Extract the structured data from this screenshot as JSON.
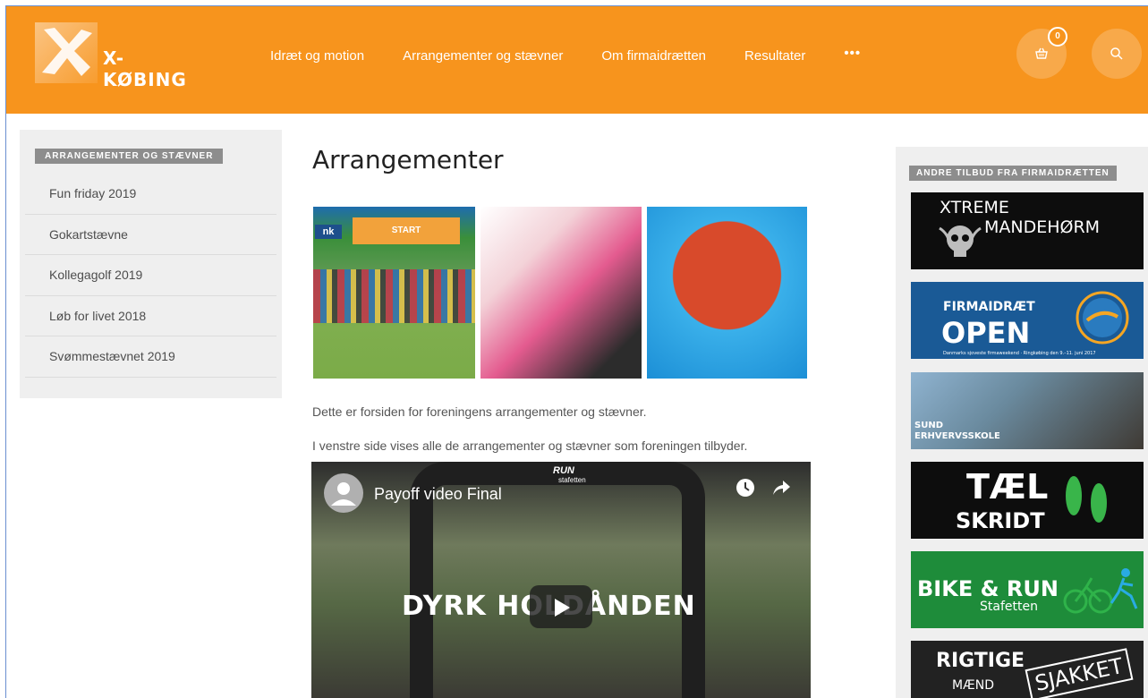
{
  "header": {
    "brand": "X-KØBING",
    "nav": [
      {
        "label": "Idræt og motion"
      },
      {
        "label": "Arrangementer og stævner"
      },
      {
        "label": "Om firmaidrætten"
      },
      {
        "label": "Resultater"
      }
    ],
    "more_label": "•••",
    "cart_count": "0",
    "cart_icon": "basket-icon",
    "search_icon": "search-icon",
    "accent_color": "#f7941d"
  },
  "sidebar": {
    "heading": "ARRANGEMENTER OG STÆVNER",
    "items": [
      {
        "label": "Fun friday 2019"
      },
      {
        "label": "Gokartstævne"
      },
      {
        "label": "Kollegagolf 2019"
      },
      {
        "label": "Løb for livet 2018"
      },
      {
        "label": "Svømmestævnet 2019"
      }
    ]
  },
  "main": {
    "title": "Arrangementer",
    "hero_banner": "START",
    "hero_side_text": "nk",
    "paragraphs": [
      "Dette er forsiden for foreningens arrangementer og stævner.",
      "I venstre side vises alle de arrangementer og stævner som foreningen tilbyder."
    ],
    "video": {
      "title": "Payoff video Final",
      "overlay_text": "DYRK HOLDÅNDEN",
      "arch_text": "RUN",
      "arch_subtext": "stafetten"
    }
  },
  "right_sidebar": {
    "heading": "ANDRE TILBUD FRA FIRMAIDRÆTTEN",
    "ads": [
      {
        "line1": "XTREME",
        "line2": "MANDEHØRM",
        "bg": "#0d0d0d"
      },
      {
        "line1": "FIRMAIDRÆT",
        "line2": "OPEN",
        "line3": "Danmarks sjoveste firmaweekend · Ringkøbing den 9.–11. juni 2017",
        "bg": "#1a5a96"
      },
      {
        "line1": "SUND",
        "line2": "ERHVERVSSKOLE",
        "bg": "#6d8a9e"
      },
      {
        "line1": "TÆL",
        "line2": "SKRIDT",
        "bg": "#0d0d0d"
      },
      {
        "line1": "BIKE & RUN",
        "line2": "Stafetten",
        "bg": "#1e8c3a"
      },
      {
        "line1": "RIGTIGE",
        "line2": "MÆND",
        "line3": "SJAKKET",
        "bg": "#222222"
      }
    ]
  }
}
